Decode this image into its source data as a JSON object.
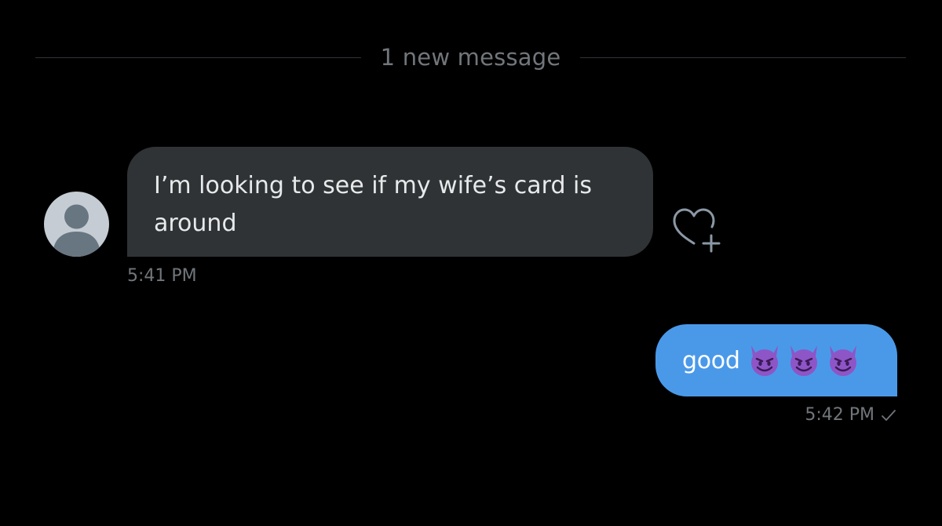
{
  "divider": {
    "label": "1 new message"
  },
  "incoming": {
    "text": "I’m looking to see if my wife’s card is around",
    "time": "5:41 PM",
    "avatar_icon": "default-profile-icon",
    "reaction_icon": "heart-plus-icon"
  },
  "outgoing": {
    "text": "good",
    "emoji_icon": "smiling-devil-emoji",
    "emoji_count": 3,
    "time": "5:42 PM",
    "status_icon": "checkmark-icon"
  },
  "colors": {
    "background": "#000000",
    "incoming_bubble": "#2f3336",
    "outgoing_bubble": "#4a99e9",
    "muted_text": "#71767b"
  }
}
